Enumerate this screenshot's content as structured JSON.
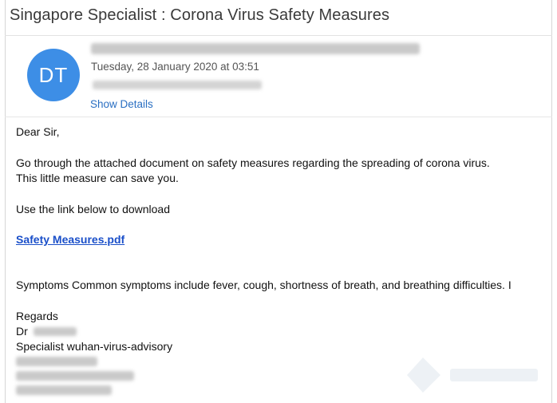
{
  "email": {
    "subject": "Singapore Specialist  : Corona Virus Safety Measures",
    "avatar_initials": "DT",
    "date": "Tuesday, 28 January 2020 at 03:51",
    "show_details": "Show Details"
  },
  "body": {
    "greeting": "Dear Sir,",
    "para1_line1": "Go through the attached document on safety measures regarding the spreading of corona virus.",
    "para1_line2": "This little measure can save you.",
    "para2": "Use the link below to download",
    "link_text": "Safety Measures.pdf",
    "symptoms": "Symptoms  Common symptoms include fever, cough, shortness of breath, and breathing difficulties. I",
    "regards": "Regards",
    "dr_prefix": "Dr",
    "signature_title": "Specialist wuhan-virus-advisory"
  },
  "colors": {
    "avatar": "#3d8ee6",
    "link": "#1a4fc9",
    "show_details": "#2a6fc2"
  }
}
